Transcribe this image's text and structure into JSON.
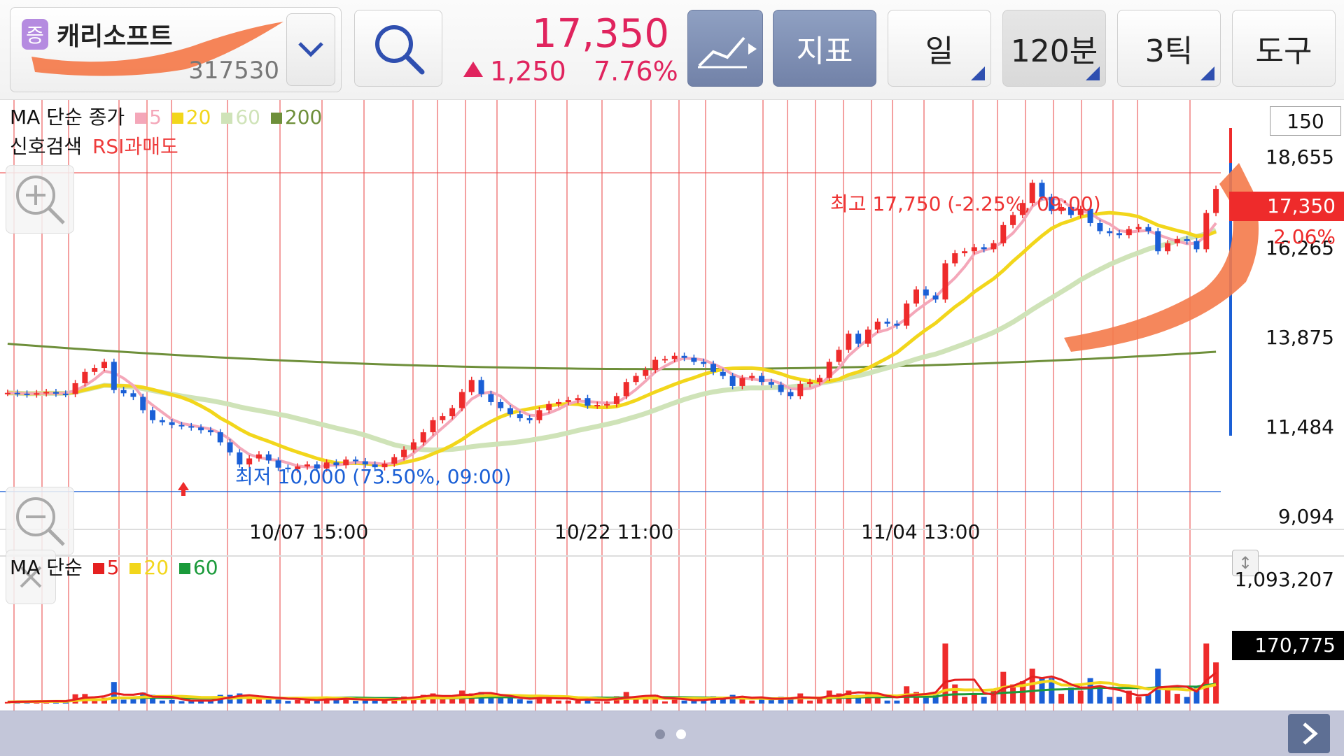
{
  "stock": {
    "badge": "증",
    "name": "캐리소프트",
    "code": "317530"
  },
  "quote": {
    "price": "17,350",
    "change": "1,250",
    "change_pct": "7.76%",
    "up_color": "#e0245e"
  },
  "toolbar": {
    "chart_type_icon": "line-chart-icon",
    "indicator_label": "지표",
    "day_label": "일",
    "interval_label": "120분",
    "tick_label": "3틱",
    "tools_label": "도구"
  },
  "price_panel": {
    "legend": {
      "ma_label": "MA 단순 종가",
      "p5": "5",
      "p20": "20",
      "p60": "60",
      "p200": "200"
    },
    "signal": {
      "label": "신호검색",
      "value": "RSI과매도"
    },
    "period_box": "150",
    "y_ticks": [
      "18,655",
      "16,265",
      "13,875",
      "11,484",
      "9,094"
    ],
    "current_price_tag": "17,350",
    "current_pct_tag": "2.06%",
    "high_annotation": "최고 17,750 (-2.25%, 09:00)",
    "low_annotation": "최저 10,000 (73.50%, 09:00)",
    "x_labels": [
      "10/07 15:00",
      "10/22 11:00",
      "11/04 13:00"
    ]
  },
  "volume_panel": {
    "legend": {
      "ma_label": "MA 단순",
      "p5": "5",
      "p20": "20",
      "p60": "60"
    },
    "max_tick": "1,093,207",
    "current_tag": "170,775"
  },
  "colors": {
    "ma5": "#f4a7b9",
    "ma20": "#f2d61b",
    "ma60": "#cfe3b8",
    "ma200": "#6e8f3a",
    "up": "#ee2b2b",
    "down": "#1a5fd6",
    "grid_v": "#f08080",
    "vol_ma5": "#e52020",
    "vol_ma20": "#f2d61b",
    "vol_ma60": "#1a9a3a",
    "annotation_arrow": "#f47a4a"
  },
  "chart_data": {
    "type": "candlestick",
    "interval": "120분",
    "y_range": [
      9094,
      18655
    ],
    "high": 17750,
    "low": 10000,
    "close": [
      12280,
      12260,
      12240,
      12270,
      12300,
      12260,
      12250,
      12520,
      12800,
      12900,
      13050,
      12350,
      12270,
      12180,
      11850,
      11600,
      11550,
      11480,
      11450,
      11420,
      11350,
      11300,
      11050,
      10800,
      10500,
      10650,
      10750,
      10600,
      10420,
      10380,
      10450,
      10500,
      10400,
      10550,
      10480,
      10620,
      10580,
      10500,
      10430,
      10520,
      10680,
      10870,
      11050,
      11300,
      11600,
      11700,
      11900,
      12300,
      12600,
      12250,
      12050,
      11900,
      11750,
      11650,
      11600,
      11850,
      12000,
      12050,
      12100,
      12150,
      11960,
      11980,
      12000,
      12200,
      12550,
      12700,
      12850,
      13100,
      13120,
      13200,
      13150,
      13050,
      13000,
      12800,
      12700,
      12450,
      12650,
      12700,
      12550,
      12480,
      12300,
      12200,
      12500,
      12550,
      12650,
      13050,
      13350,
      13750,
      13500,
      13850,
      14050,
      14000,
      13950,
      14500,
      14850,
      14700,
      14600,
      15500,
      15750,
      15800,
      15900,
      15850,
      16000,
      16450,
      16700,
      17000,
      17500,
      17150,
      16800,
      16900,
      16700,
      16850,
      16500,
      16300,
      16250,
      16200,
      16350,
      16400,
      16300,
      15800,
      16000,
      16100,
      16050,
      15850,
      16750,
      17350
    ]
  }
}
